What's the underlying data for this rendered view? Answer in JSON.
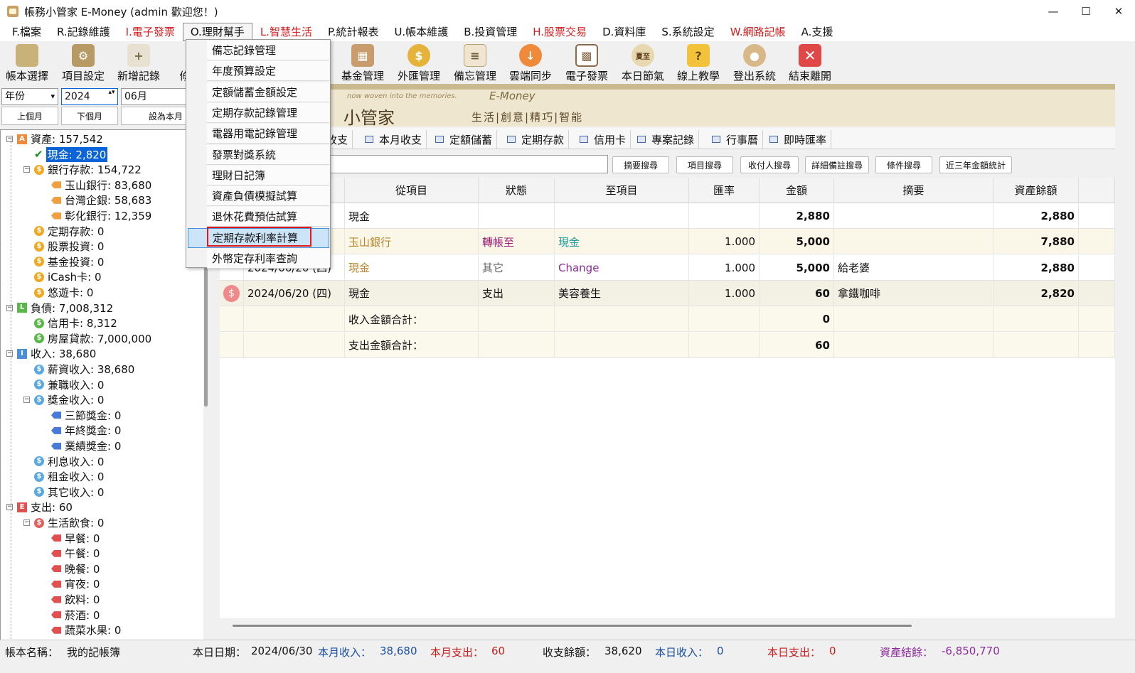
{
  "window": {
    "title": "帳務小管家 E-Money (admin 歡迎您！)",
    "minimize": "—",
    "maximize": "☐",
    "close": "✕"
  },
  "menu": [
    {
      "label": "F.檔案",
      "red": false
    },
    {
      "label": "R.記錄維護",
      "red": false
    },
    {
      "label": "I.電子發票",
      "red": true
    },
    {
      "label": "O.理財幫手",
      "red": false,
      "open": true
    },
    {
      "label": "L.智慧生活",
      "red": true
    },
    {
      "label": "P.統計報表",
      "red": false
    },
    {
      "label": "U.帳本維護",
      "red": false
    },
    {
      "label": "B.投資管理",
      "red": false
    },
    {
      "label": "H.股票交易",
      "red": true
    },
    {
      "label": "D.資料庫",
      "red": false
    },
    {
      "label": "S.系統設定",
      "red": false
    },
    {
      "label": "W.網路記帳",
      "red": true
    },
    {
      "label": "A.支援",
      "red": false
    }
  ],
  "toolbar": {
    "left": [
      "帳本選擇",
      "項目設定",
      "新增記錄",
      "修"
    ],
    "right": [
      "基金管理",
      "外匯管理",
      "備忘管理",
      "雲端同步",
      "電子發票",
      "本日節氣",
      "線上教學",
      "登出系統",
      "結束離開"
    ],
    "icons": {
      "jieqi": "夏至",
      "help": "?",
      "exit": "✕",
      "coin": "$"
    }
  },
  "filters": {
    "period": "年份",
    "year": "2024",
    "month": "06月",
    "prev": "上個月",
    "next": "下個月",
    "set": "設為本月",
    "caret": "▾",
    "spin": "▴▾"
  },
  "banner": {
    "tagline": "now woven into the memories.",
    "brand": "E-Money",
    "name": "小管家",
    "motto": "生活|創意|精巧|智能"
  },
  "tree": [
    {
      "label": "資產: 157,542",
      "lvl": 0,
      "kind": "A",
      "exp": "−"
    },
    {
      "label": "現金: 2,820",
      "lvl": 1,
      "kind": "check",
      "selected": true
    },
    {
      "label": "銀行存款: 154,722",
      "lvl": 1,
      "kind": "coin",
      "exp": "−"
    },
    {
      "label": "玉山銀行: 83,680",
      "lvl": 2,
      "kind": "tag"
    },
    {
      "label": "台灣企銀: 58,683",
      "lvl": 2,
      "kind": "tag"
    },
    {
      "label": "彰化銀行: 12,359",
      "lvl": 2,
      "kind": "tag"
    },
    {
      "label": "定期存款: 0",
      "lvl": 1,
      "kind": "coin"
    },
    {
      "label": "股票投資: 0",
      "lvl": 1,
      "kind": "coin"
    },
    {
      "label": "基金投資: 0",
      "lvl": 1,
      "kind": "coin"
    },
    {
      "label": "iCash卡: 0",
      "lvl": 1,
      "kind": "coin"
    },
    {
      "label": "悠遊卡: 0",
      "lvl": 1,
      "kind": "coin"
    },
    {
      "label": "負債: 7,008,312",
      "lvl": 0,
      "kind": "L",
      "exp": "−"
    },
    {
      "label": "信用卡: 8,312",
      "lvl": 1,
      "kind": "coin"
    },
    {
      "label": "房屋貸款: 7,000,000",
      "lvl": 1,
      "kind": "coin"
    },
    {
      "label": "收入: 38,680",
      "lvl": 0,
      "kind": "I",
      "exp": "−"
    },
    {
      "label": "薪資收入: 38,680",
      "lvl": 1,
      "kind": "coin"
    },
    {
      "label": "兼職收入: 0",
      "lvl": 1,
      "kind": "coin"
    },
    {
      "label": "獎金收入: 0",
      "lvl": 1,
      "kind": "coin",
      "exp": "−"
    },
    {
      "label": "三節獎金: 0",
      "lvl": 2,
      "kind": "tag"
    },
    {
      "label": "年終獎金: 0",
      "lvl": 2,
      "kind": "tag"
    },
    {
      "label": "業績獎金: 0",
      "lvl": 2,
      "kind": "tag"
    },
    {
      "label": "利息收入: 0",
      "lvl": 1,
      "kind": "coin"
    },
    {
      "label": "租金收入: 0",
      "lvl": 1,
      "kind": "coin"
    },
    {
      "label": "其它收入: 0",
      "lvl": 1,
      "kind": "coin"
    },
    {
      "label": "支出: 60",
      "lvl": 0,
      "kind": "E",
      "exp": "−"
    },
    {
      "label": "生活飲食: 0",
      "lvl": 1,
      "kind": "coin",
      "exp": "−"
    },
    {
      "label": "早餐: 0",
      "lvl": 2,
      "kind": "tag"
    },
    {
      "label": "午餐: 0",
      "lvl": 2,
      "kind": "tag"
    },
    {
      "label": "晚餐: 0",
      "lvl": 2,
      "kind": "tag"
    },
    {
      "label": "宵夜: 0",
      "lvl": 2,
      "kind": "tag"
    },
    {
      "label": "飲料: 0",
      "lvl": 2,
      "kind": "tag"
    },
    {
      "label": "菸酒: 0",
      "lvl": 2,
      "kind": "tag"
    },
    {
      "label": "蔬菜水果: 0",
      "lvl": 2,
      "kind": "tag"
    }
  ],
  "tabs": [
    "收支",
    "本月收支",
    "定額儲蓄",
    "定期存款",
    "信用卡",
    "專案記錄",
    "行事曆",
    "即時匯率"
  ],
  "search_buttons": [
    "摘要搜尋",
    "項目搜尋",
    "收付人搜尋",
    "詳細備註搜尋",
    "條件搜尋",
    "近三年金額統計"
  ],
  "grid": {
    "headers": [
      "從項目",
      "狀態",
      "至項目",
      "匯率",
      "金額",
      "摘要",
      "資產餘額"
    ],
    "rows": [
      {
        "icon": "",
        "date": "",
        "from": "現金",
        "status": "",
        "to": "",
        "rate": "",
        "amount": "2,880",
        "memo": "",
        "balance": "2,880",
        "bg": "#ffffff"
      },
      {
        "icon": "",
        "date": "",
        "from": "玉山銀行",
        "status": "轉帳至",
        "to": "現金",
        "rate": "1.000",
        "amount": "5,000",
        "memo": "",
        "balance": "7,880",
        "bg": "#faf6e8"
      },
      {
        "icon": "",
        "date": "2024/06/20 (四)",
        "from": "現金",
        "status": "其它",
        "to": "Change",
        "rate": "1.000",
        "amount": "5,000",
        "memo": "給老婆",
        "balance": "2,880",
        "bg": "#ffffff"
      },
      {
        "icon": "$",
        "date": "2024/06/20 (四)",
        "from": "現金",
        "status": "支出",
        "to": "美容養生",
        "rate": "1.000",
        "amount": "60",
        "memo": "拿鐵咖啡",
        "balance": "2,820",
        "bg": "#f3f0e4"
      }
    ],
    "totals": [
      {
        "label": "收入金額合計：",
        "amount": "0"
      },
      {
        "label": "支出金額合計：",
        "amount": "60"
      }
    ]
  },
  "dropdown": [
    "備忘記錄管理",
    "年度預算設定",
    "定額儲蓄金額設定",
    "定期存款記錄管理",
    "電器用電記錄管理",
    "發票對獎系統",
    "理財日記簿",
    "資產負債模擬試算",
    "退休花費預估試算",
    "定期存款利率計算",
    "外幣定存利率查詢"
  ],
  "dropdown_highlight": 9,
  "status": {
    "book_label": "帳本名稱：",
    "book": "我的記帳簿",
    "date_label": "本日日期：",
    "date": "2024/06/30",
    "month_in_label": "本月收入：",
    "month_in": "38,680",
    "month_out_label": "本月支出：",
    "month_out": "60",
    "balance_label": "收支餘額：",
    "balance": "38,620",
    "day_in_label": "本日收入：",
    "day_in": "0",
    "day_out_label": "本日支出：",
    "day_out": "0",
    "net_label": "資產結餘：",
    "net": "-6,850,770"
  },
  "colors": {
    "accent_blue": "#0a64d8",
    "income": "#1a4fa0",
    "expense": "#c81e1e",
    "net": "#8a2a9a",
    "menu_red": "#d42020",
    "highlight_border": "#e01818"
  }
}
